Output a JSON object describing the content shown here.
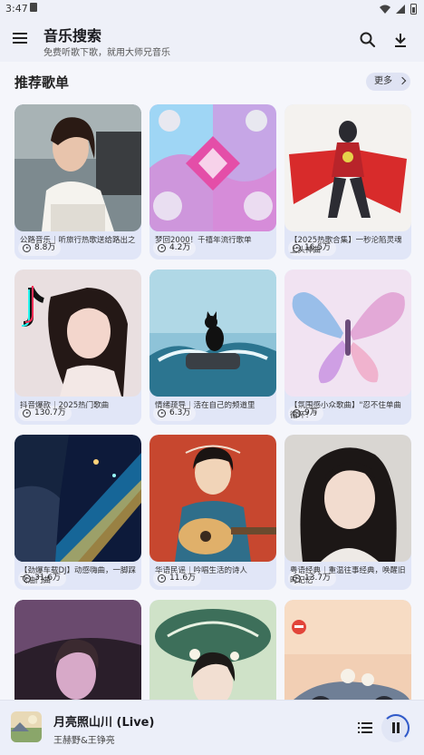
{
  "status": {
    "time": "3:47"
  },
  "app": {
    "title": "音乐搜索",
    "subtitle": "免费听歌下歌，就用大师兄音乐"
  },
  "section": {
    "title": "推荐歌单",
    "more_label": "更多"
  },
  "playlists": [
    {
      "plays": "8.8万",
      "title": "公路音乐｜听旅行热歌送给路出之"
    },
    {
      "plays": "4.2万",
      "title": "梦回2000！千禧年流行歌单"
    },
    {
      "plays": "16.5万",
      "title": "【2025热歌合集】一秒沦陷灵魂上头神曲"
    },
    {
      "plays": "130.7万",
      "title": "抖音爆款｜2025热门歌曲"
    },
    {
      "plays": "6.3万",
      "title": "情绪疏导｜活在自己的频道里"
    },
    {
      "plays": "9万",
      "title": "【氛围感小众歌曲】\"忍不住单曲循环！\""
    },
    {
      "plays": "31.6万",
      "title": "【劲爆车载DJ】动感嗨曲，一脚踩飞油门曲"
    },
    {
      "plays": "11.6万",
      "title": "华语民谣｜吟唱生活的诗人"
    },
    {
      "plays": "13.7万",
      "title": "粤语经典｜重温往事经典，唤醒旧时记忆"
    },
    {
      "plays": "",
      "title": ""
    },
    {
      "plays": "",
      "title": ""
    },
    {
      "plays": "",
      "title": ""
    }
  ],
  "player": {
    "title": "月亮照山川 (Live)",
    "artist": "王赫野&王铮亮",
    "progress": 0.3
  },
  "colors": {
    "accent": "#2f59c9",
    "card_bg": "#e1e6f7",
    "bar_bg": "#eef0f8"
  }
}
